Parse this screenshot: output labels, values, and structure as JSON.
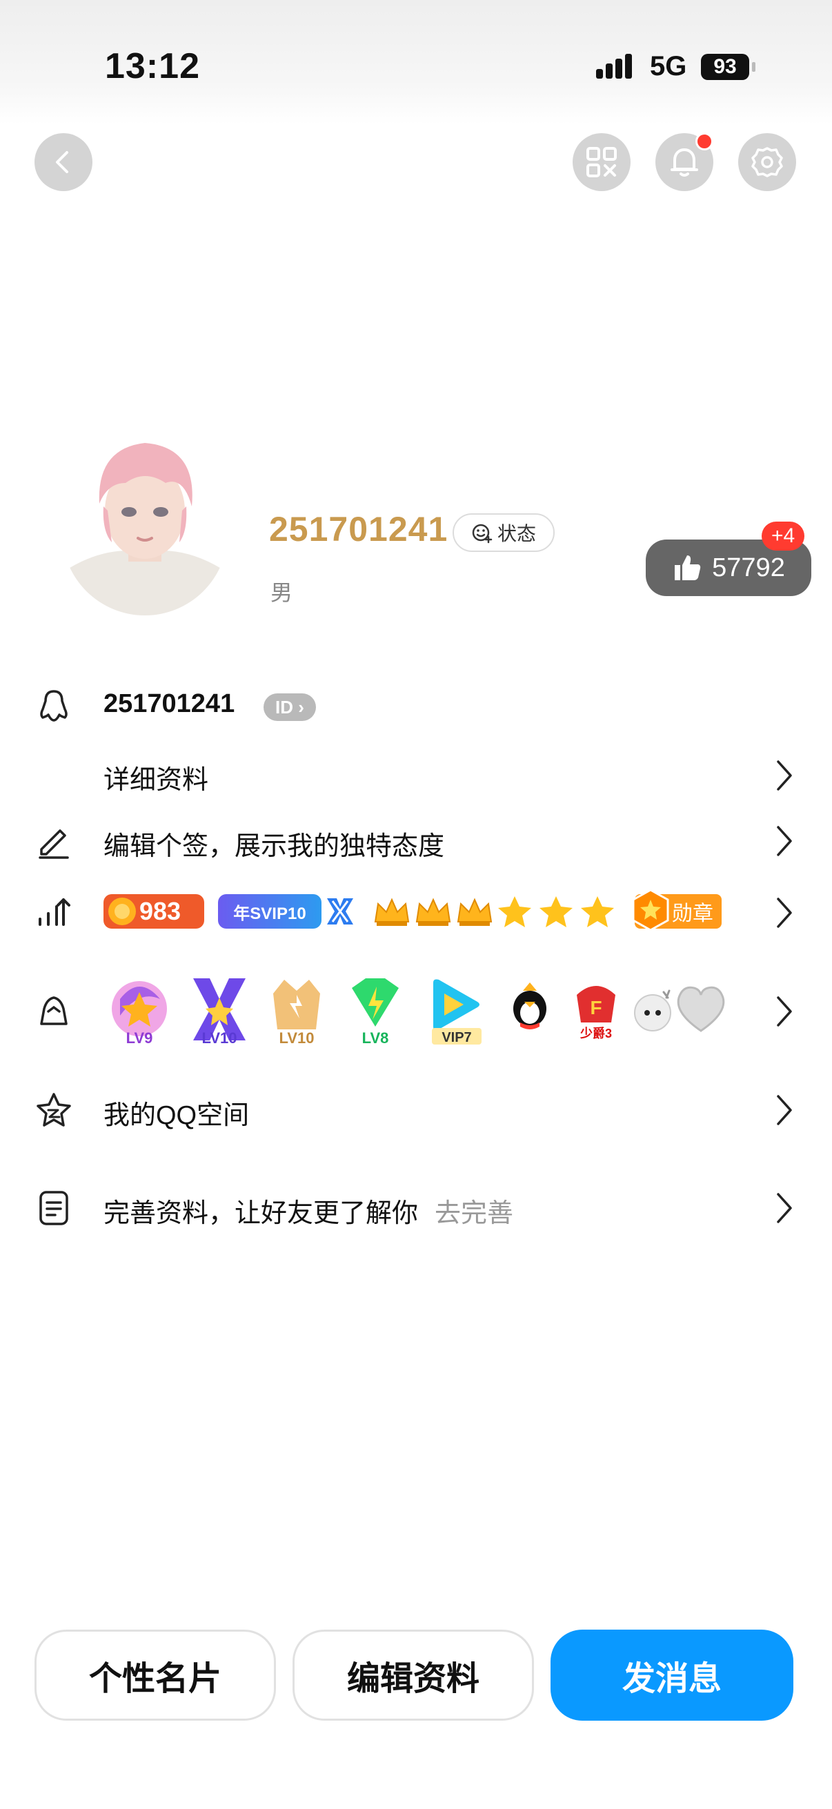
{
  "status_bar": {
    "time": "13:12",
    "network": "5G",
    "battery": "93"
  },
  "header": {
    "back": "back",
    "qr": "qr-code",
    "bell": "notifications",
    "settings": "settings"
  },
  "profile": {
    "nickname": "251701241",
    "status_label": "状态",
    "gender": "男",
    "likes": "57792",
    "likes_new": "+4"
  },
  "rows": {
    "qq_number": "251701241",
    "id_tag": "ID",
    "details": "详细资料",
    "signature": "编辑个签，展示我的独特态度",
    "qzone": "我的QQ空间",
    "complete": "完善资料，让好友更了解你",
    "complete_hint": "去完善"
  },
  "badges": {
    "coin": "983",
    "svip": "年SVIP10",
    "medal": "勋章"
  },
  "vip_icons": [
    {
      "label": "LV9"
    },
    {
      "label": "LV10"
    },
    {
      "label": "LV10"
    },
    {
      "label": "LV8"
    },
    {
      "label": "VIP7"
    },
    {
      "label": ""
    },
    {
      "label": "少爵3"
    }
  ],
  "bottom": {
    "card": "个性名片",
    "edit": "编辑资料",
    "message": "发消息"
  },
  "colors": {
    "accent": "#0A99FF",
    "nickname": "#C99A4F",
    "alert": "#FF3B30"
  }
}
